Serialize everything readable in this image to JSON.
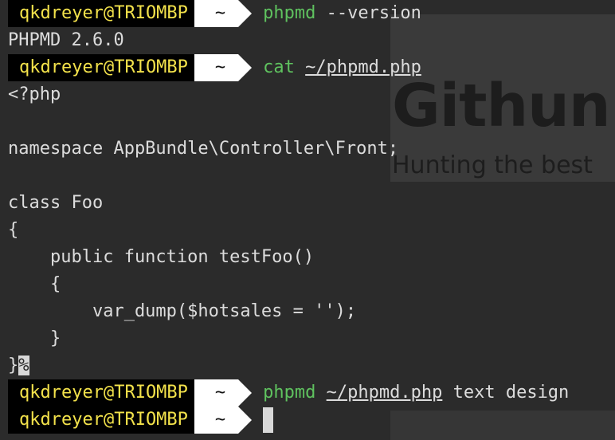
{
  "background_window": {
    "title": "Githun",
    "subtitle": "Hunting the best"
  },
  "colors": {
    "terminal_bg": "#2b2b2b",
    "prompt_user_bg": "#000000",
    "prompt_user_fg": "#f3e24b",
    "prompt_dir_bg": "#ffffff",
    "command_name": "#5fc25f",
    "text": "#dcdcdc"
  },
  "prompt": {
    "user_host": "qkdreyer@TRIOMBP",
    "dir": "~"
  },
  "commands": [
    {
      "name": "phpmd",
      "args": " --version"
    },
    {
      "name": "cat",
      "path": "~/phpmd.php"
    },
    {
      "name": "phpmd",
      "path": "~/phpmd.php",
      "args": " text design"
    }
  ],
  "output": {
    "version": "PHPMD 2.6.0",
    "file_lines": [
      "<?php",
      "",
      "namespace AppBundle\\Controller\\Front;",
      "",
      "class Foo",
      "{",
      "    public function testFoo()",
      "    {",
      "        var_dump($hotsales = '');",
      "    }",
      "}"
    ],
    "no_newline_marker": "%"
  }
}
